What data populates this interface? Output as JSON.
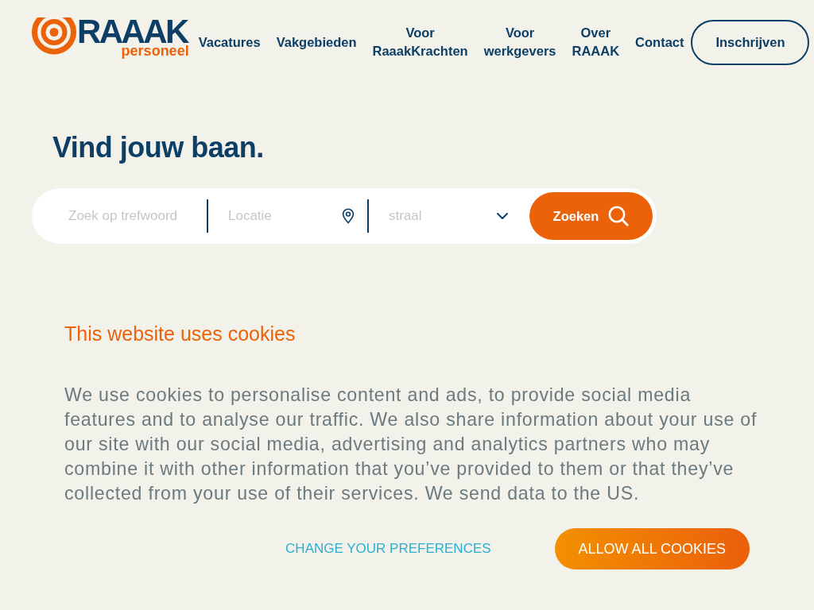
{
  "header": {
    "logo": {
      "wordmark": "RAAAK",
      "tagline": "personeel"
    },
    "nav": [
      {
        "label": "Vacatures"
      },
      {
        "label": "Vakgebieden"
      },
      {
        "label": "Voor RaaakKrachten"
      },
      {
        "label": "Voor werkgevers"
      },
      {
        "label": "Over RAAAK"
      },
      {
        "label": "Contact"
      }
    ],
    "signup_button": "Inschrijven"
  },
  "hero": {
    "title": "Vind jouw baan.",
    "search": {
      "keyword": {
        "placeholder": "Zoek op trefwoord"
      },
      "location": {
        "placeholder": "Locatie"
      },
      "radius": {
        "placeholder": "straal"
      },
      "button": "Zoeken"
    }
  },
  "cookie_banner": {
    "title": "This website uses cookies",
    "text": "We use cookies to personalise content and ads, to provide social media features and to analyse our traffic. We also share information about your use of our site with our social media, advertising and analytics partners who may combine it with other information that you’ve provided to them or that they’ve collected from your use of their services. We send data to the US.",
    "preferences_link": "CHANGE YOUR PREFERENCES",
    "allow_button": "ALLOW ALL COOKIES"
  }
}
